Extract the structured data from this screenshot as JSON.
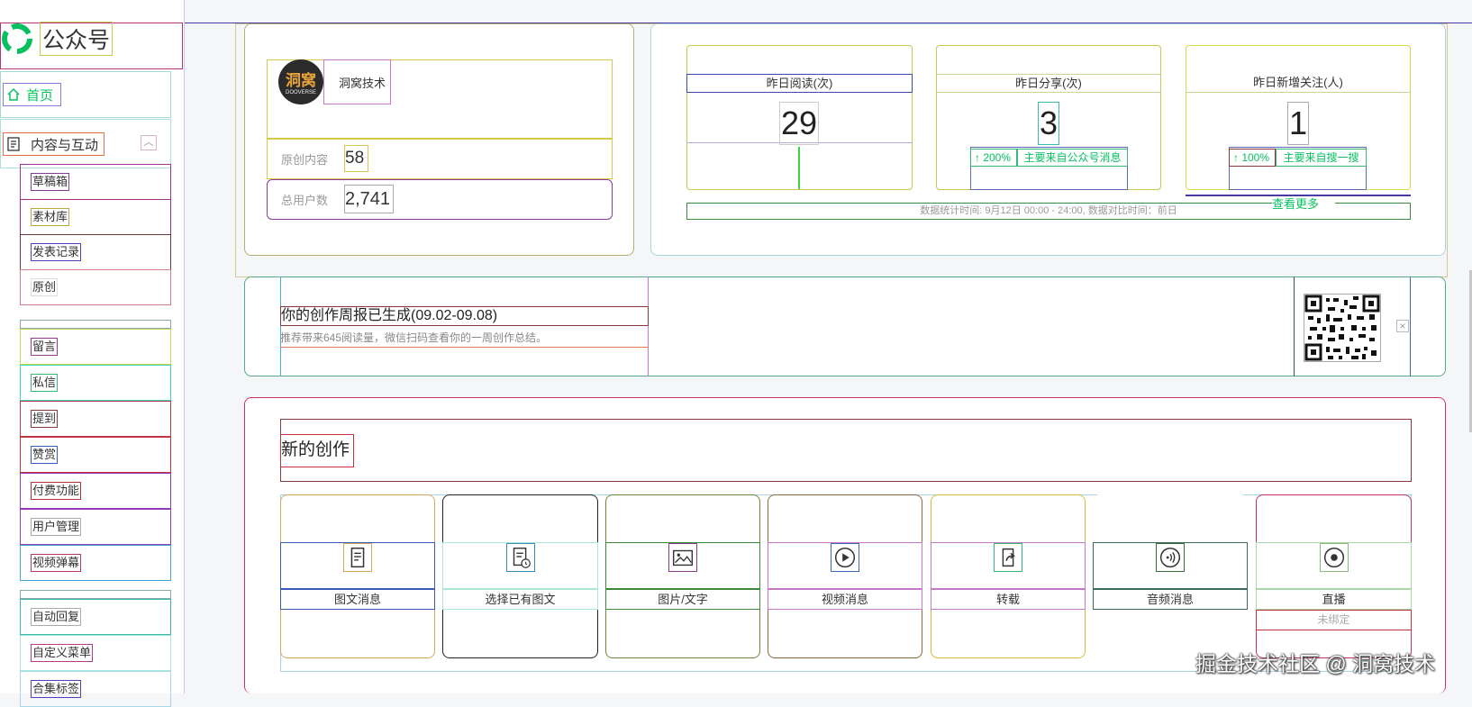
{
  "app": {
    "title": "公众号"
  },
  "sidebar": {
    "home": "首页",
    "group": "内容与互动",
    "items": [
      "草稿箱",
      "素材库",
      "发表记录",
      "原创",
      "留言",
      "私信",
      "提到",
      "赞赏",
      "付费功能",
      "用户管理",
      "视频弹幕",
      "自动回复",
      "自定义菜单",
      "合集标签"
    ]
  },
  "account": {
    "name": "洞窝技术",
    "avatar_text": "洞窝",
    "avatar_sub": "DOOVERSE",
    "original_label": "原创内容",
    "original_value": "58",
    "users_label": "总用户数",
    "users_value": "2,741"
  },
  "stats": [
    {
      "label": "昨日阅读(次)",
      "value": "29"
    },
    {
      "label": "昨日分享(次)",
      "value": "3",
      "change": "↑ 200%",
      "source": "主要来自公众号消息"
    },
    {
      "label": "昨日新增关注(人)",
      "value": "1",
      "change": "↑ 100%",
      "source": "主要来自搜一搜"
    }
  ],
  "stats_footer": "数据统计时间: 9月12日 00:00 - 24:00, 数据对比时间：前日",
  "see_more": "查看更多",
  "weekly": {
    "title": "你的创作周报已生成(09.02-09.08)",
    "desc": "推荐带来645阅读量，微信扫码查看你的一周创作总结。"
  },
  "create": {
    "title": "新的创作",
    "items": [
      {
        "label": "图文消息",
        "icon": "article-icon"
      },
      {
        "label": "选择已有图文",
        "icon": "article-history-icon"
      },
      {
        "label": "图片/文字",
        "icon": "image-icon"
      },
      {
        "label": "视频消息",
        "icon": "video-play-icon"
      },
      {
        "label": "转载",
        "icon": "share-icon"
      },
      {
        "label": "音频消息",
        "icon": "audio-icon"
      },
      {
        "label": "直播",
        "icon": "live-icon",
        "sub": "未绑定"
      }
    ]
  },
  "watermark": "掘金技术社区 @ 洞窝技术"
}
